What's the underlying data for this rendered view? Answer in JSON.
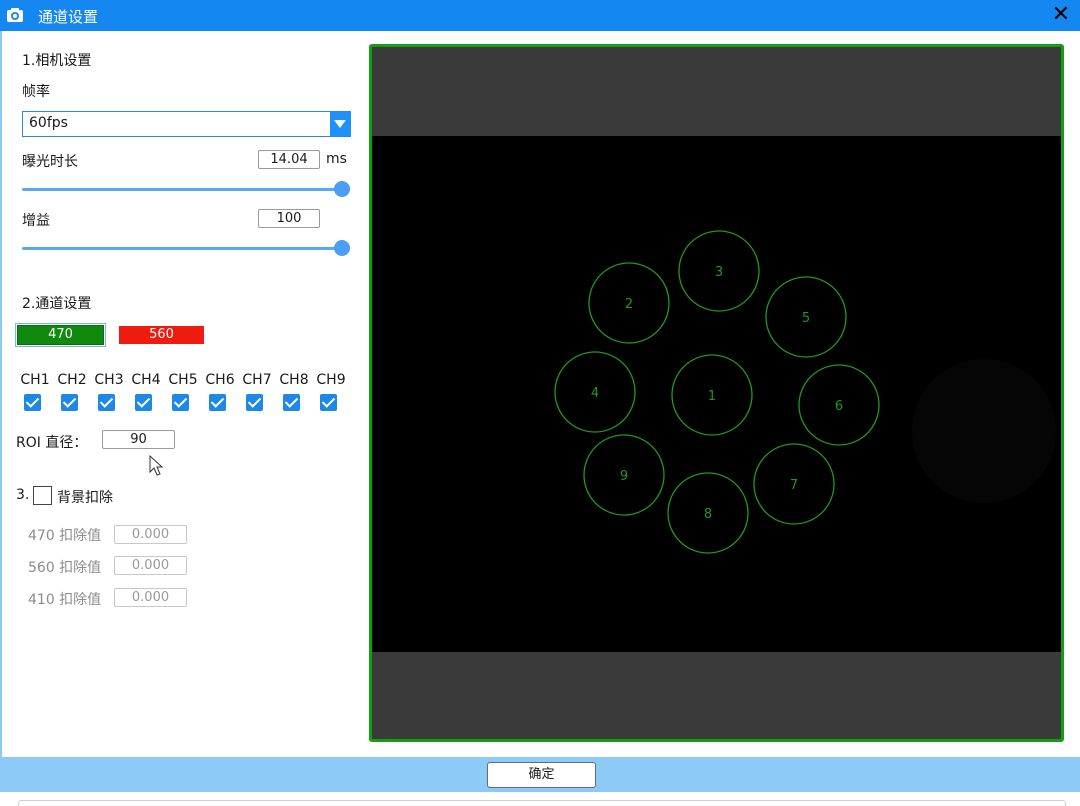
{
  "window": {
    "title": "通道设置",
    "close_glyph": "✕"
  },
  "camera": {
    "section_title": "1.相机设置",
    "framerate_label": "帧率",
    "framerate_value": "60fps",
    "exposure_label": "曝光时长",
    "exposure_value": "14.04",
    "exposure_unit": "ms",
    "exposure_slider_level": 1.0,
    "gain_label": "增益",
    "gain_value": "100",
    "gain_slider_level": 1.0
  },
  "channel": {
    "section_title": "2.通道设置",
    "wavelength_buttons": [
      {
        "label": "470",
        "color": "#0f8a0f",
        "selected": true
      },
      {
        "label": "560",
        "color": "#ee1c0e",
        "selected": false
      }
    ],
    "channels": [
      "CH1",
      "CH2",
      "CH3",
      "CH4",
      "CH5",
      "CH6",
      "CH7",
      "CH8",
      "CH9"
    ],
    "roi_label": "ROI 直径：",
    "roi_value": "90"
  },
  "background": {
    "section_prefix": "3.",
    "checkbox_label": "背景扣除",
    "checked": false,
    "rows": [
      {
        "label": "470 扣除值",
        "value": "0.000"
      },
      {
        "label": "560 扣除值",
        "value": "0.000"
      },
      {
        "label": "410 扣除值",
        "value": "0.000"
      }
    ]
  },
  "viewer": {
    "roi_labels": [
      "1",
      "2",
      "3",
      "4",
      "5",
      "6",
      "7",
      "8",
      "9"
    ],
    "roi_color": "#1f9a1f",
    "border_color": "#12a012"
  },
  "footer": {
    "ok_label": "确定"
  }
}
